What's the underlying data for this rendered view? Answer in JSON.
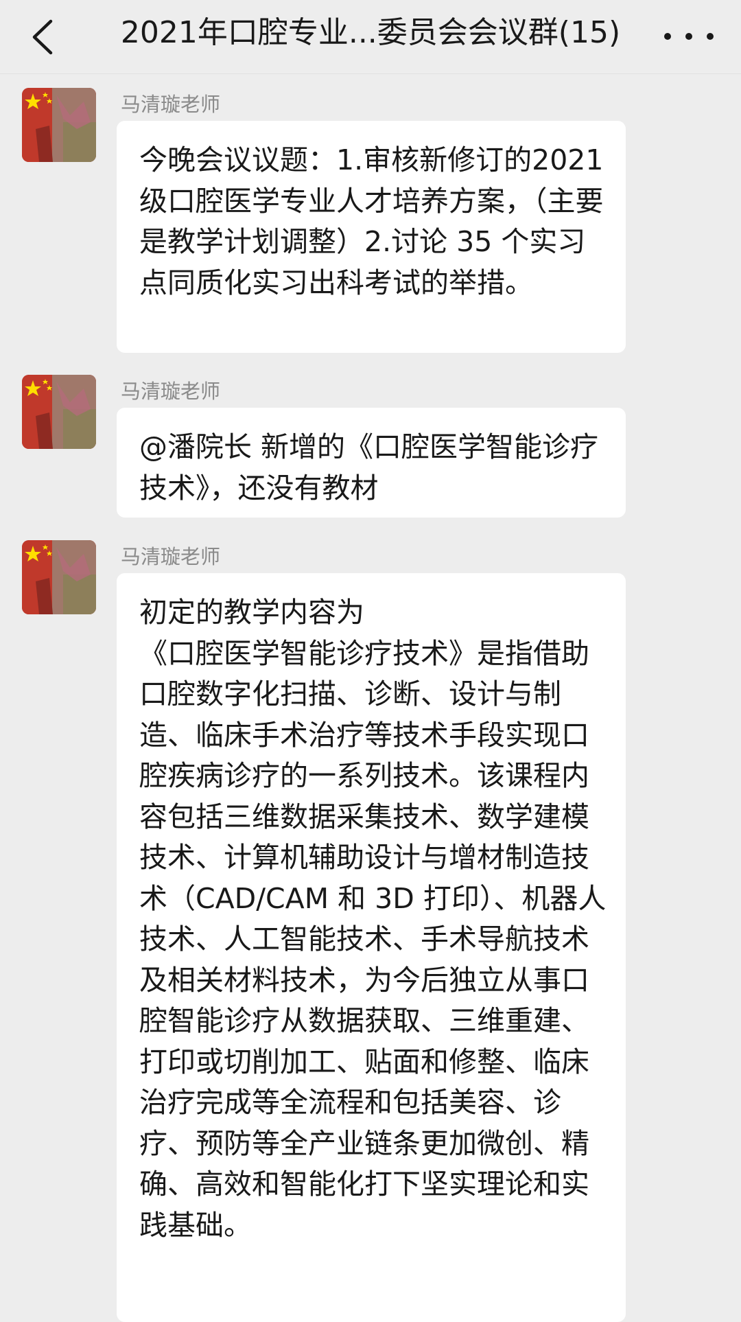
{
  "header": {
    "title": "2021年口腔专业...委员会会议群(15)"
  },
  "messages": [
    {
      "sender": "马清璇老师",
      "text": "今晚会议议题：1.审核新修订的2021 级口腔医学专业人才培养方案，（主要是教学计划调整）2.讨论 35 个实习点同质化实习出科考试的举措。"
    },
    {
      "sender": "马清璇老师",
      "text": "@潘院长  新增的《口腔医学智能诊疗技术》，还没有教材"
    },
    {
      "sender": "马清璇老师",
      "text": "初定的教学内容为\n《口腔医学智能诊疗技术》是指借助口腔数字化扫描、诊断、设计与制造、临床手术治疗等技术手段实现口腔疾病诊疗的一系列技术。该课程内容包括三维数据采集技术、数学建模技术、计算机辅助设计与增材制造技术（CAD/CAM 和 3D 打印）、机器人技术、人工智能技术、手术导航技术及相关材料技术，为今后独立从事口腔智能诊疗从数据获取、三维重建、打印或切削加工、贴面和修整、临床治疗完成等全流程和包括美容、诊疗、预防等全产业链条更加微创、精确、高效和智能化打下坚实理论和实践基础。"
    }
  ]
}
